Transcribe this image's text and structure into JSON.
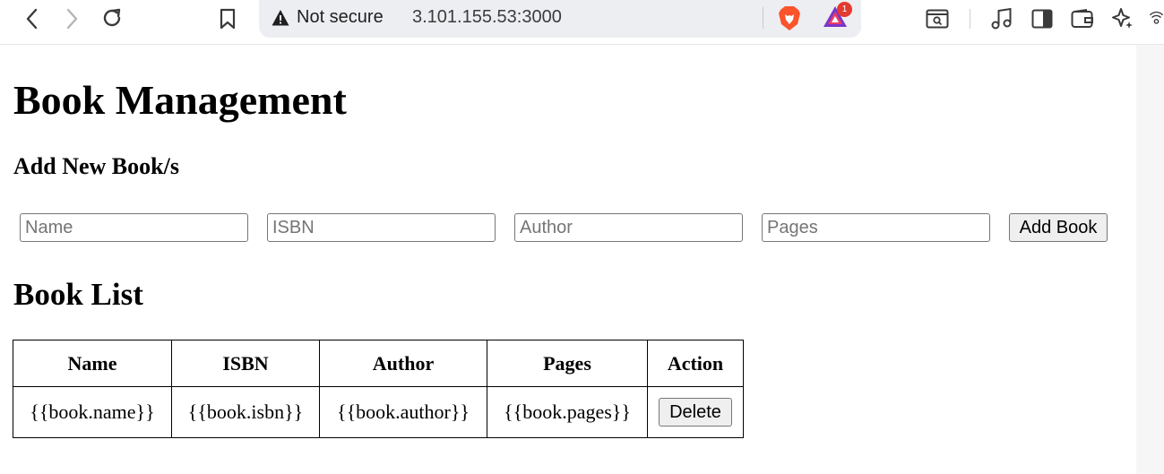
{
  "browser": {
    "security_label": "Not secure",
    "url": "3.101.155.53:3000",
    "rewards_badge": "1"
  },
  "page": {
    "title": "Book Management",
    "add_heading": "Add New Book/s",
    "form": {
      "name_placeholder": "Name",
      "isbn_placeholder": "ISBN",
      "author_placeholder": "Author",
      "pages_placeholder": "Pages",
      "name_value": "",
      "isbn_value": "",
      "author_value": "",
      "pages_value": "",
      "submit_label": "Add Book"
    },
    "list_heading": "Book List",
    "table": {
      "headers": [
        "Name",
        "ISBN",
        "Author",
        "Pages",
        "Action"
      ],
      "rows": [
        {
          "name": "{{book.name}}",
          "isbn": "{{book.isbn}}",
          "author": "{{book.author}}",
          "pages": "{{book.pages}}",
          "action_label": "Delete"
        }
      ]
    }
  },
  "colors": {
    "omnibox_bg": "#eceef2",
    "brave_orange": "#fb542b",
    "badge_red": "#e23a30",
    "button_bg": "#efefef"
  },
  "icons": {
    "back": "back-arrow-icon",
    "forward": "forward-arrow-icon",
    "reload": "reload-icon",
    "bookmark": "bookmark-icon",
    "warning": "warning-triangle-icon",
    "brave": "brave-shields-icon",
    "rewards": "brave-rewards-icon",
    "search_tab": "search-tabs-icon",
    "media": "music-note-icon",
    "sidebar": "sidebar-icon",
    "wallet": "wallet-icon",
    "leo": "leo-ai-icon",
    "vpn": "vpn-icon"
  }
}
